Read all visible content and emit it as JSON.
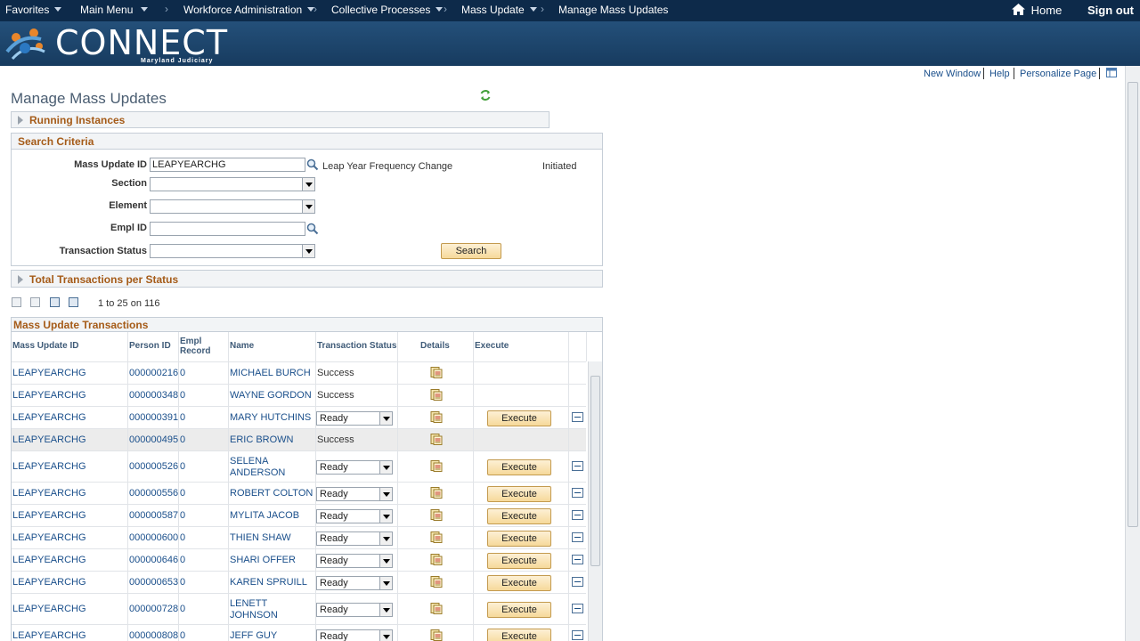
{
  "topnav": {
    "favorites": "Favorites",
    "main_menu": "Main Menu",
    "breadcrumb": [
      "Workforce Administration",
      "Collective Processes",
      "Mass Update",
      "Manage Mass Updates"
    ],
    "home": "Home",
    "sign_out": "Sign out"
  },
  "banner": {
    "logo_text": "CONNECT",
    "logo_sub": "Maryland Judiciary"
  },
  "util_links": {
    "new_window": "New Window",
    "help": "Help",
    "personalize_page": "Personalize Page"
  },
  "page_title": "Manage Mass Updates",
  "running_instances": {
    "title": "Running Instances"
  },
  "search_criteria": {
    "title": "Search Criteria",
    "mass_update_id_label": "Mass Update ID",
    "mass_update_id_value": "LEAPYEARCHG",
    "mass_update_desc": "Leap Year Frequency Change",
    "mass_update_status": "Initiated",
    "section_label": "Section",
    "element_label": "Element",
    "empl_id_label": "Empl ID",
    "transaction_status_label": "Transaction Status",
    "search_button": "Search"
  },
  "total_transactions": {
    "title": "Total Transactions per Status"
  },
  "pagination": {
    "text": "1 to 25 on 116"
  },
  "transactions": {
    "title": "Mass Update Transactions",
    "columns": {
      "mass_update_id": "Mass Update ID",
      "person_id": "Person ID",
      "empl_record_1": "Empl",
      "empl_record_2": "Record",
      "name": "Name",
      "transaction_status": "Transaction Status",
      "details": "Details",
      "execute": "Execute"
    },
    "rows": [
      {
        "id": "LEAPYEARCHG",
        "person": "000000216",
        "rec": "0",
        "name1": "MICHAEL BURCH",
        "name2": "",
        "status": "Success",
        "editable": false
      },
      {
        "id": "LEAPYEARCHG",
        "person": "000000348",
        "rec": "0",
        "name1": "WAYNE GORDON",
        "name2": "",
        "status": "Success",
        "editable": false
      },
      {
        "id": "LEAPYEARCHG",
        "person": "000000391",
        "rec": "0",
        "name1": "MARY HUTCHINS",
        "name2": "",
        "status": "Ready",
        "editable": true
      },
      {
        "id": "LEAPYEARCHG",
        "person": "000000495",
        "rec": "0",
        "name1": "ERIC BROWN",
        "name2": "",
        "status": "Success",
        "editable": false
      },
      {
        "id": "LEAPYEARCHG",
        "person": "000000526",
        "rec": "0",
        "name1": "SELENA",
        "name2": "ANDERSON",
        "status": "Ready",
        "editable": true
      },
      {
        "id": "LEAPYEARCHG",
        "person": "000000556",
        "rec": "0",
        "name1": "ROBERT COLTON",
        "name2": "",
        "status": "Ready",
        "editable": true
      },
      {
        "id": "LEAPYEARCHG",
        "person": "000000587",
        "rec": "0",
        "name1": "MYLITA JACOB",
        "name2": "",
        "status": "Ready",
        "editable": true
      },
      {
        "id": "LEAPYEARCHG",
        "person": "000000600",
        "rec": "0",
        "name1": "THIEN SHAW",
        "name2": "",
        "status": "Ready",
        "editable": true
      },
      {
        "id": "LEAPYEARCHG",
        "person": "000000646",
        "rec": "0",
        "name1": "SHARI OFFER",
        "name2": "",
        "status": "Ready",
        "editable": true
      },
      {
        "id": "LEAPYEARCHG",
        "person": "000000653",
        "rec": "0",
        "name1": "KAREN SPRUILL",
        "name2": "",
        "status": "Ready",
        "editable": true
      },
      {
        "id": "LEAPYEARCHG",
        "person": "000000728",
        "rec": "0",
        "name1": "LENETT",
        "name2": "JOHNSON",
        "status": "Ready",
        "editable": true
      },
      {
        "id": "LEAPYEARCHG",
        "person": "000000808",
        "rec": "0",
        "name1": "JEFF GUY",
        "name2": "",
        "status": "Ready",
        "editable": true
      }
    ],
    "execute_label": "Execute"
  }
}
